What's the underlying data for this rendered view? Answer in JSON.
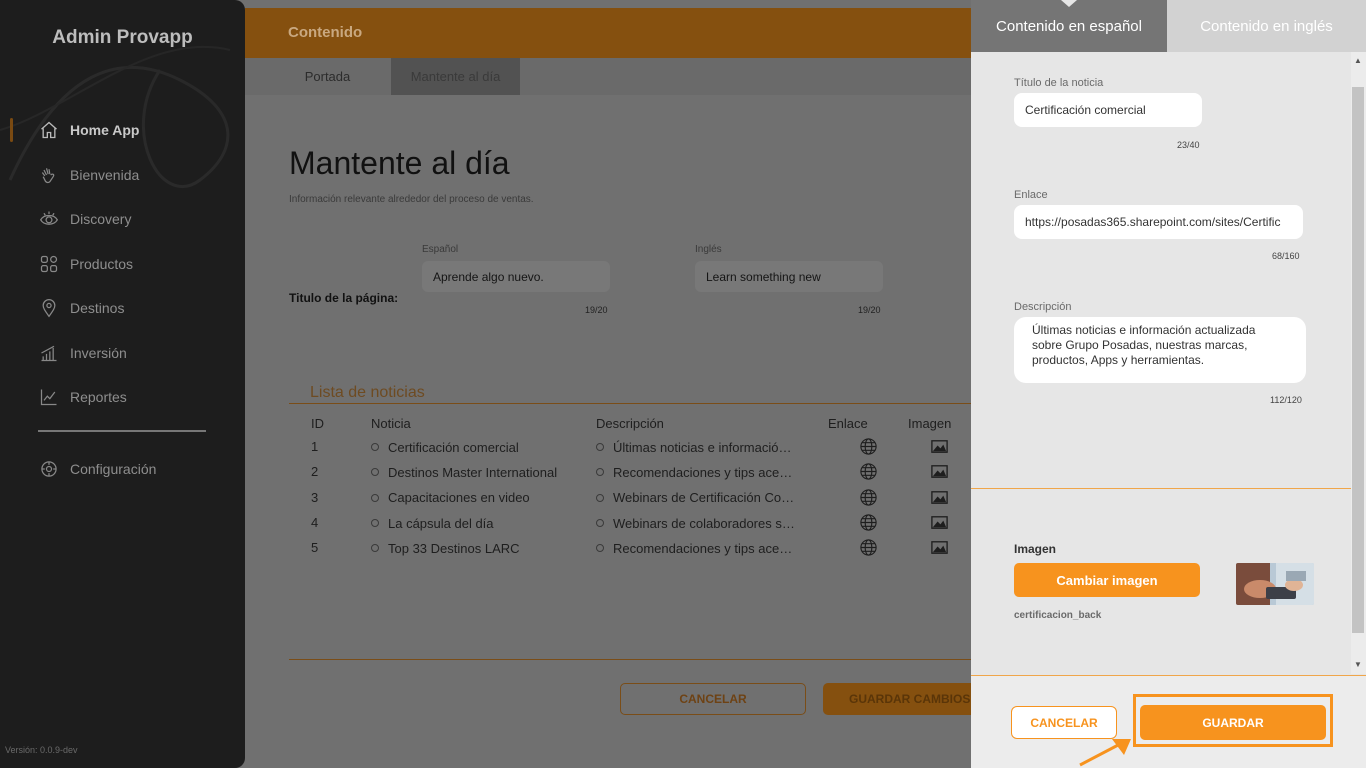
{
  "sidebar": {
    "brand": "Admin Provapp",
    "items": [
      {
        "label": "Home App",
        "icon": "home-icon",
        "active": true
      },
      {
        "label": "Bienvenida",
        "icon": "wave-hand-icon"
      },
      {
        "label": "Discovery",
        "icon": "eye-icon"
      },
      {
        "label": "Productos",
        "icon": "grid-icon"
      },
      {
        "label": "Destinos",
        "icon": "map-pin-icon"
      },
      {
        "label": "Inversión",
        "icon": "bar-chart-icon"
      },
      {
        "label": "Reportes",
        "icon": "line-chart-icon"
      }
    ],
    "config": {
      "label": "Configuración",
      "icon": "gear-icon"
    },
    "version": "Versión: 0.0.9-dev"
  },
  "main": {
    "topbar_title": "Contenido",
    "tabs": [
      {
        "label": "Portada"
      },
      {
        "label": "Mantente al día",
        "active": true
      }
    ],
    "heading": "Mantente al día",
    "subheading": "Información relevante alrededor del proceso de ventas.",
    "page_title_label": "Titulo de la página:",
    "spanish": {
      "label": "Español",
      "value": "Aprende algo nuevo.",
      "counter": "19/20"
    },
    "english": {
      "label": "Inglés",
      "value": "Learn something new",
      "counter": "19/20"
    },
    "list_title": "Lista de noticias",
    "columns": [
      "ID",
      "Noticia",
      "Descripción",
      "Enlace",
      "Imagen"
    ],
    "rows": [
      {
        "id": "1",
        "noticia": "Certificación comercial",
        "descripcion": "Últimas noticias e información actualizada"
      },
      {
        "id": "2",
        "noticia": "Destinos Master International",
        "descripcion": "Recomendaciones y tips acerca de"
      },
      {
        "id": "3",
        "noticia": "Capacitaciones en video",
        "descripcion": "Webinars de Certificación Comercial"
      },
      {
        "id": "4",
        "noticia": "La cápsula del día",
        "descripcion": "Webinars de colaboradores sobre"
      },
      {
        "id": "5",
        "noticia": "Top 33 Destinos LARC",
        "descripcion": "Recomendaciones y tips acerca de"
      }
    ],
    "cancel_label": "CANCELAR",
    "save_label": "GUARDAR CAMBIOS"
  },
  "drawer": {
    "tabs": [
      {
        "label": "Contenido en español",
        "active": true
      },
      {
        "label": "Contenido en inglés"
      }
    ],
    "title_field": {
      "label": "Título de la noticia",
      "value": "Certificación comercial",
      "counter": "23/40"
    },
    "link_field": {
      "label": "Enlace",
      "value": "https://posadas365.sharepoint.com/sites/Certific",
      "counter": "68/160"
    },
    "desc_field": {
      "label": "Descripción",
      "value": "Últimas noticias e información actualizada sobre Grupo Posadas, nuestras marcas, productos, Apps y herramientas.",
      "counter": "112/120"
    },
    "image_label": "Imagen",
    "change_image_label": "Cambiar imagen",
    "image_filename": "certificacion_back",
    "cancel_label": "CANCELAR",
    "save_label": "GUARDAR"
  },
  "colors": {
    "accent": "#f7931e",
    "sidebar_bg": "#1d1d1d",
    "drawer_bg": "#e6e6e6"
  }
}
